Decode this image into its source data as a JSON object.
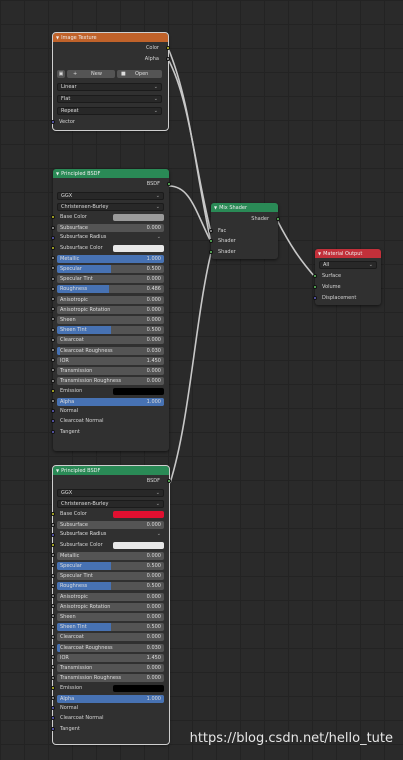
{
  "image_texture": {
    "title": "Image Texture",
    "outputs": [
      "Color",
      "Alpha"
    ],
    "new_label": "New",
    "open_label": "Open",
    "interpolation": "Linear",
    "projection": "Flat",
    "extension": "Repeat",
    "input_vector": "Vector"
  },
  "bsdf1": {
    "title": "Principled BSDF",
    "output": "BSDF",
    "distribution": "GGX",
    "subsurface_method": "Christensen-Burley",
    "base_color_label": "Base Color",
    "base_color": "#9a9a9a",
    "rows": [
      {
        "label": "Subsurface",
        "value": "0.000",
        "fill": 0
      },
      {
        "label": "Subsurface Radius",
        "value": ""
      },
      {
        "label": "Subsurface Color",
        "value": ""
      },
      {
        "label": "Metallic",
        "value": "1.000",
        "fill": 1
      },
      {
        "label": "Specular",
        "value": "0.500",
        "fill": 0.5
      },
      {
        "label": "Specular Tint",
        "value": "0.000",
        "fill": 0
      },
      {
        "label": "Roughness",
        "value": "0.486",
        "fill": 0.486
      },
      {
        "label": "Anisotropic",
        "value": "0.000",
        "fill": 0
      },
      {
        "label": "Anisotropic Rotation",
        "value": "0.000",
        "fill": 0
      },
      {
        "label": "Sheen",
        "value": "0.000",
        "fill": 0
      },
      {
        "label": "Sheen Tint",
        "value": "0.500",
        "fill": 0.5
      },
      {
        "label": "Clearcoat",
        "value": "0.000",
        "fill": 0
      },
      {
        "label": "Clearcoat Roughness",
        "value": "0.030",
        "fill": 0.03
      },
      {
        "label": "IOR",
        "value": "1.450",
        "fill": 0
      },
      {
        "label": "Transmission",
        "value": "0.000",
        "fill": 0
      },
      {
        "label": "Transmission Roughness",
        "value": "0.000",
        "fill": 0
      }
    ],
    "emission_label": "Emission",
    "emission_color": "#000000",
    "alpha_label": "Alpha",
    "alpha_value": "1.000",
    "alpha_fill": 1,
    "vectors": [
      "Normal",
      "Clearcoat Normal",
      "Tangent"
    ]
  },
  "bsdf2": {
    "title": "Principled BSDF",
    "output": "BSDF",
    "distribution": "GGX",
    "subsurface_method": "Christensen-Burley",
    "base_color_label": "Base Color",
    "base_color": "#e01030",
    "rows": [
      {
        "label": "Subsurface",
        "value": "0.000",
        "fill": 0
      },
      {
        "label": "Subsurface Radius",
        "value": ""
      },
      {
        "label": "Subsurface Color",
        "value": ""
      },
      {
        "label": "Metallic",
        "value": "0.000",
        "fill": 0
      },
      {
        "label": "Specular",
        "value": "0.500",
        "fill": 0.5
      },
      {
        "label": "Specular Tint",
        "value": "0.000",
        "fill": 0
      },
      {
        "label": "Roughness",
        "value": "0.500",
        "fill": 0.5
      },
      {
        "label": "Anisotropic",
        "value": "0.000",
        "fill": 0
      },
      {
        "label": "Anisotropic Rotation",
        "value": "0.000",
        "fill": 0
      },
      {
        "label": "Sheen",
        "value": "0.000",
        "fill": 0
      },
      {
        "label": "Sheen Tint",
        "value": "0.500",
        "fill": 0.5
      },
      {
        "label": "Clearcoat",
        "value": "0.000",
        "fill": 0
      },
      {
        "label": "Clearcoat Roughness",
        "value": "0.030",
        "fill": 0.03
      },
      {
        "label": "IOR",
        "value": "1.450",
        "fill": 0
      },
      {
        "label": "Transmission",
        "value": "0.000",
        "fill": 0
      },
      {
        "label": "Transmission Roughness",
        "value": "0.000",
        "fill": 0
      }
    ],
    "emission_label": "Emission",
    "emission_color": "#000000",
    "alpha_label": "Alpha",
    "alpha_value": "1.000",
    "alpha_fill": 1,
    "vectors": [
      "Normal",
      "Clearcoat Normal",
      "Tangent"
    ]
  },
  "mix_shader": {
    "title": "Mix Shader",
    "output": "Shader",
    "inputs": [
      "Fac",
      "Shader",
      "Shader"
    ]
  },
  "material_output": {
    "title": "Material Output",
    "target": "All",
    "inputs": [
      "Surface",
      "Volume",
      "Displacement"
    ]
  },
  "colors": {
    "texture_header": "#c0622a",
    "shader_header": "#2a8a56",
    "output_header": "#c2303a",
    "value_fill": "#4772b3"
  },
  "watermark": "https://blog.csdn.net/hello_tute"
}
